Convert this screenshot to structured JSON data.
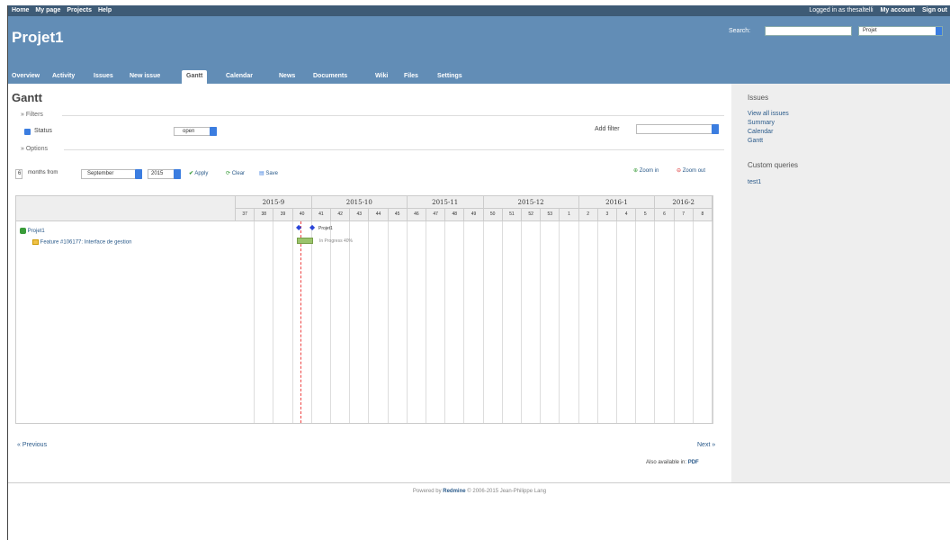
{
  "top_menu": {
    "left": [
      "Home",
      "My page",
      "Projects",
      "Help"
    ],
    "logged_in": "Logged in as thesaltelli",
    "my_account": "My account",
    "sign_out": "Sign out"
  },
  "header": {
    "project_title": "Projet1",
    "search_label": "Search:",
    "search_value": "",
    "project_select": "Projet"
  },
  "tabs": [
    "Overview",
    "Activity",
    "Issues",
    "New issue",
    "Gantt",
    "Calendar",
    "News",
    "Documents",
    "Wiki",
    "Files",
    "Settings"
  ],
  "selected_tab": "Gantt",
  "page": {
    "title": "Gantt",
    "filters_legend": "Filters",
    "status_label": "Status",
    "status_value": "open",
    "add_filter_label": "Add filter",
    "add_filter_value": "",
    "options_legend": "Options"
  },
  "toolbar": {
    "months_value": "6",
    "months_from_label": "months from",
    "month_value": "September",
    "year_value": "2015",
    "apply": "Apply",
    "clear": "Clear",
    "save": "Save",
    "zoom_in": "Zoom in",
    "zoom_out": "Zoom out"
  },
  "gantt": {
    "months": [
      "2015-9",
      "2015-10",
      "2015-11",
      "2015-12",
      "2016-1",
      "2016-2"
    ],
    "weeks": [
      "37",
      "38",
      "39",
      "40",
      "41",
      "42",
      "43",
      "44",
      "45",
      "46",
      "47",
      "48",
      "49",
      "50",
      "51",
      "52",
      "53",
      "1",
      "2",
      "3",
      "4",
      "5",
      "6",
      "7",
      "8"
    ],
    "project_label": "Projet1",
    "issue_label": "Feature #106177: Interface de gestion",
    "project_bar_label": "Projet1",
    "issue_bar_label": "In Progress 40%",
    "issue_progress": 0.4
  },
  "nav": {
    "previous": "« Previous",
    "next": "Next »",
    "also_available": "Also available in:",
    "pdf": "PDF"
  },
  "sidebar": {
    "issues_heading": "Issues",
    "links": [
      "View all issues",
      "Summary",
      "Calendar",
      "Gantt"
    ],
    "custom_queries_heading": "Custom queries",
    "queries": [
      "test1"
    ]
  },
  "footer": {
    "powered_by": "Powered by",
    "redmine": "Redmine",
    "copyright": "© 2006-2015 Jean-Philippe Lang"
  },
  "colors": {
    "header": "#628db6",
    "top_menu": "#3e5b76",
    "sidebar": "#eeeeee",
    "bar": "#9bc36b",
    "today_line": "#e44444"
  }
}
